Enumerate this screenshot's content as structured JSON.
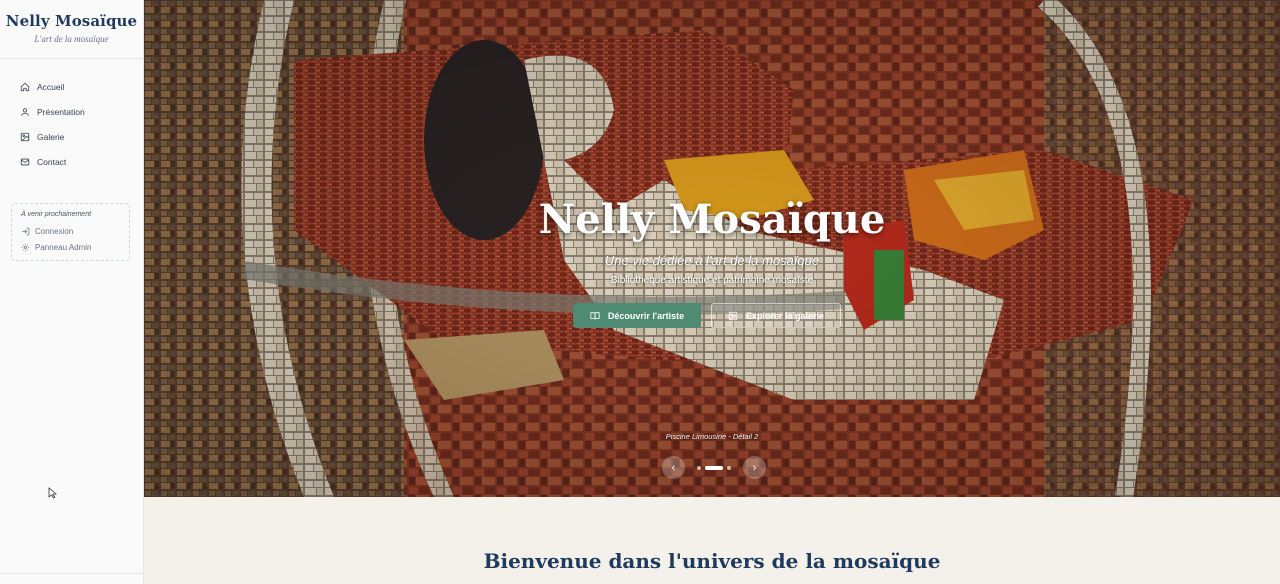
{
  "sidebar": {
    "brand_title": "Nelly Mosaïque",
    "brand_subtitle": "L'art de la mosaïque",
    "items": [
      {
        "label": "Accueil",
        "icon": "home-icon"
      },
      {
        "label": "Présentation",
        "icon": "user-icon"
      },
      {
        "label": "Galerie",
        "icon": "image-icon"
      },
      {
        "label": "Contact",
        "icon": "mail-icon"
      }
    ],
    "coming_soon": {
      "title": "À venir prochainement",
      "items": [
        {
          "label": "Connexion",
          "icon": "login-icon"
        },
        {
          "label": "Panneau Admin",
          "icon": "gear-icon"
        }
      ]
    }
  },
  "hero": {
    "title": "Nelly Mosaïque",
    "subtitle": "Une vie dédiée à l'art de la mosaïque",
    "tagline": "Bibliothèque artistique et patrimoine mosaïste",
    "primary_button": "Découvrir l'artiste",
    "secondary_button": "Explorer la galerie",
    "caption": "Piscine Limousine - Détail 2",
    "prev_label": "‹",
    "next_label": "›",
    "slide_count": 3,
    "active_slide": 2
  },
  "welcome": {
    "heading": "Bienvenue dans l'univers de la mosaïque"
  },
  "colors": {
    "brand_navy": "#1e3a5f",
    "accent_green": "#4f8a73",
    "section_bg": "#f4f1ea"
  }
}
